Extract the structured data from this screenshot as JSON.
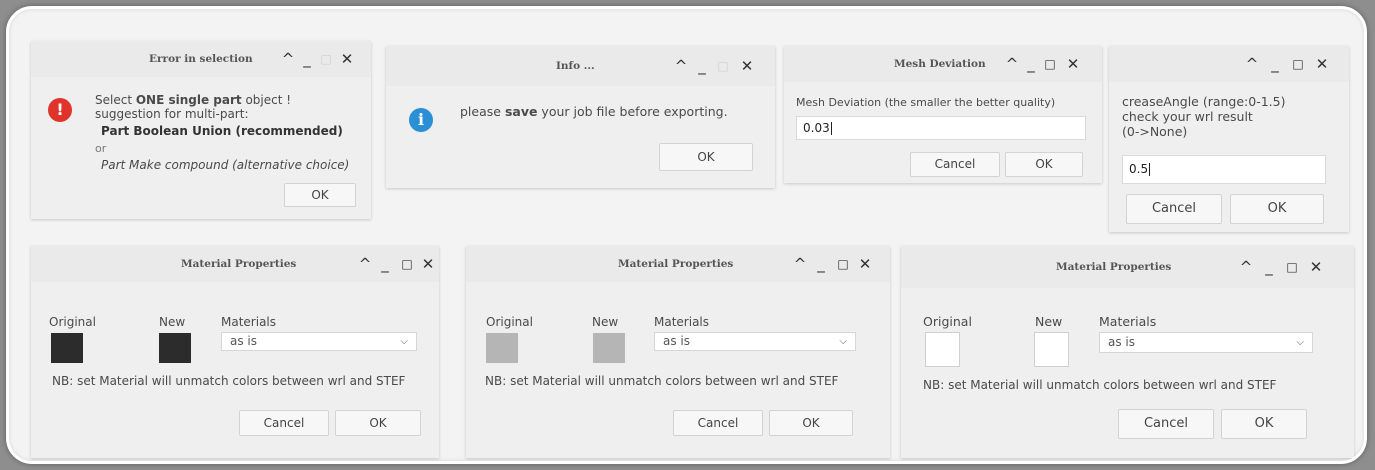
{
  "window_controls": {
    "minimize": "^",
    "restore": "_",
    "maximize": "□",
    "close": "✕"
  },
  "error_dialog": {
    "title": "Error in selection",
    "line1_prefix": "Select ",
    "line1_bold": "ONE single part",
    "line1_suffix": " object !",
    "line2": "suggestion for multi-part:",
    "line3": "Part Boolean Union (recommended)",
    "line4": "or",
    "line5": "Part Make compound (alternative choice)",
    "ok": "OK",
    "icon_color": "#e0332b"
  },
  "info_dialog": {
    "title": "Info ...",
    "msg_prefix": "please ",
    "msg_bold": "save",
    "msg_suffix": " your job file before exporting.",
    "ok": "OK",
    "icon_color": "#2b8fd6"
  },
  "mesh_dialog": {
    "title": "Mesh Deviation",
    "label": "Mesh Deviation (the smaller the better quality)",
    "value": "0.03",
    "cancel": "Cancel",
    "ok": "OK"
  },
  "crease_dialog": {
    "label1": "creaseAngle (range:0-1.5)",
    "label2": "check your wrl result",
    "label3": "(0->None)",
    "value": "0.5",
    "cancel": "Cancel",
    "ok": "OK"
  },
  "material_dialogs": [
    {
      "title": "Material Properties",
      "original": "Original",
      "new": "New",
      "materials": "Materials",
      "select_value": "as is",
      "note": "NB: set Material will unmatch colors between wrl and STEF",
      "cancel": "Cancel",
      "ok": "OK",
      "swatch_color": "#2c2c2c"
    },
    {
      "title": "Material Properties",
      "original": "Original",
      "new": "New",
      "materials": "Materials",
      "select_value": "as is",
      "note": "NB: set Material will unmatch colors between wrl and STEF",
      "cancel": "Cancel",
      "ok": "OK",
      "swatch_color": "#b5b5b5"
    },
    {
      "title": "Material Properties",
      "original": "Original",
      "new": "New",
      "materials": "Materials",
      "select_value": "as is",
      "note": "NB: set Material will unmatch colors between wrl and STEF",
      "cancel": "Cancel",
      "ok": "OK",
      "swatch_color": "#ffffff"
    }
  ]
}
